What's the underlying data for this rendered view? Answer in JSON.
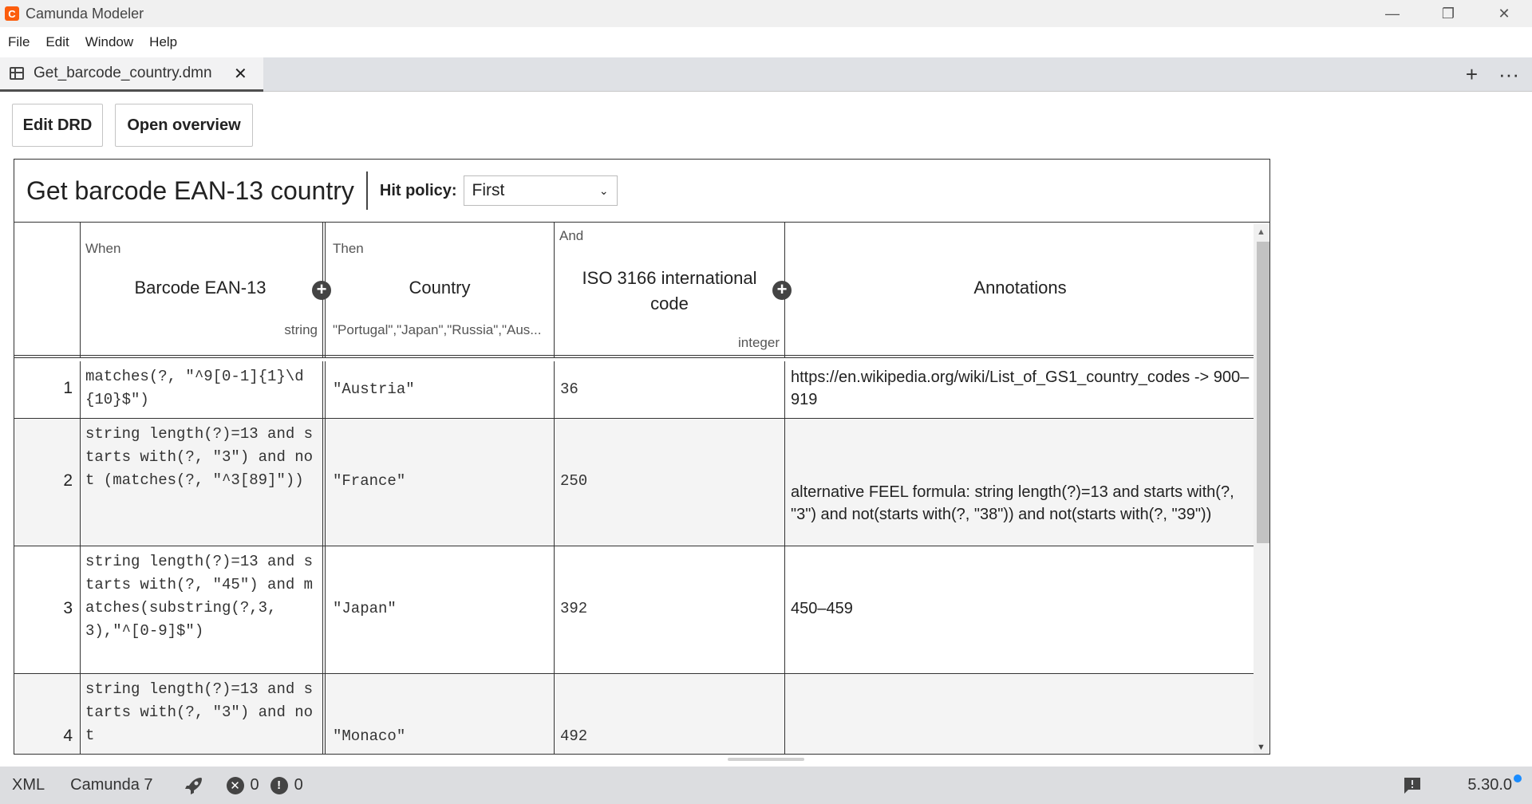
{
  "window": {
    "app_icon": "camunda-icon",
    "title": "Camunda Modeler",
    "controls": {
      "minimize": "—",
      "restore": "❐",
      "close": "✕"
    }
  },
  "menu": {
    "items": [
      "File",
      "Edit",
      "Window",
      "Help"
    ]
  },
  "tab": {
    "label": "Get_barcode_country.dmn",
    "close": "✕",
    "add": "+",
    "more": "···"
  },
  "toolbar": {
    "edit_drd": "Edit DRD",
    "open_overview": "Open overview"
  },
  "decision": {
    "name": "Get barcode EAN-13 country",
    "hit_policy_label": "Hit policy:",
    "hit_policy_value": "First",
    "hit_policy_chevron": "⌄"
  },
  "columns": {
    "input": {
      "clause": "When",
      "label": "Barcode EAN-13",
      "type": "string"
    },
    "output1": {
      "clause": "Then",
      "label": "Country",
      "type": "\"Portugal\",\"Japan\",\"Russia\",\"Aus..."
    },
    "output2": {
      "clause": "And",
      "label": "ISO 3166 international code",
      "type": "integer"
    },
    "annotations": {
      "label": "Annotations"
    },
    "add_symbol": "+"
  },
  "rules": [
    {
      "num": "1",
      "input": "matches(?, \"^9[0-1]{1}\\d{10}$\")",
      "country": "\"Austria\"",
      "code": "36",
      "annotation": "https://en.wikipedia.org/wiki/List_of_GS1_country_codes -> 900–919"
    },
    {
      "num": "2",
      "input": "string length(?)=13 and starts with(?, \"3\") and not (matches(?, \"^3[89]\"))",
      "country": "\"France\"",
      "code": "250",
      "annotation": "alternative FEEL formula: string length(?)=13 and starts with(?, \"3\") and not(starts with(?, \"38\")) and not(starts with(?, \"39\"))"
    },
    {
      "num": "3",
      "input": "string length(?)=13 and starts with(?, \"45\") and matches(substring(?,3,3),\"^[0-9]$\")",
      "country": "\"Japan\"",
      "code": "392",
      "annotation": "450–459"
    },
    {
      "num": "4",
      "input": "string length(?)=13 and starts with(?, \"3\") and not",
      "country": "\"Monaco\"",
      "code": "492",
      "annotation": ""
    }
  ],
  "statusbar": {
    "xml": "XML",
    "engine": "Camunda 7",
    "deploy_icon": "rocket-icon",
    "errors": "0",
    "warnings": "0",
    "error_symbol": "✕",
    "warning_symbol": "!",
    "feedback_icon": "feedback-icon",
    "version": "5.30.0"
  }
}
